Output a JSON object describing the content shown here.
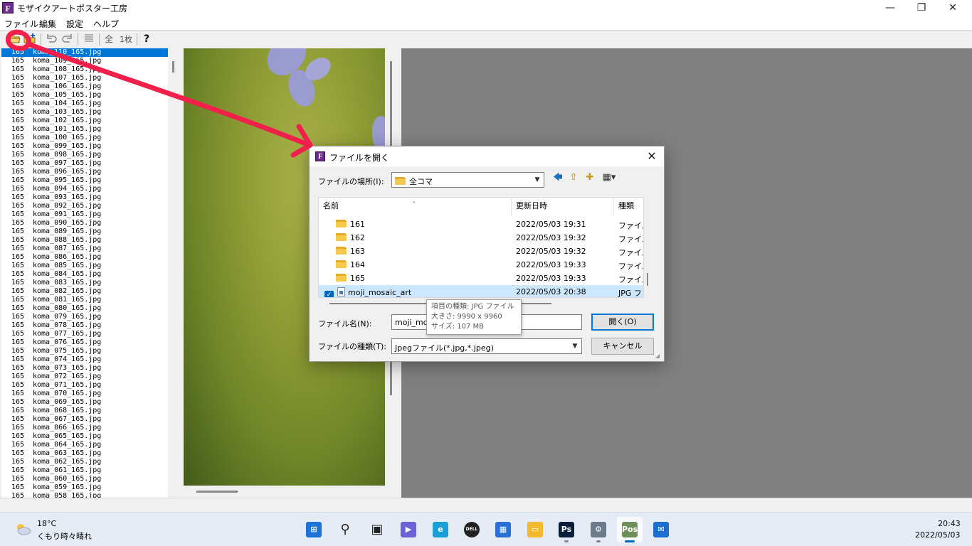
{
  "window": {
    "title": "モザイクアートポスター工房",
    "icon_letter": "F",
    "controls": {
      "minimize": "—",
      "maximize": "❐",
      "close": "✕"
    }
  },
  "menu": [
    "ファイル",
    "編集",
    "設定",
    "ヘルプ"
  ],
  "toolbar": {
    "buttons": [
      "open-folder-icon",
      "new-icon",
      "undo-icon",
      "redo-icon",
      "list-icon",
      "all-icon",
      "one-sheet-icon",
      "help-icon"
    ],
    "all_label": "全",
    "one_label": "1枚",
    "help_label": "?"
  },
  "file_list": {
    "items": [
      {
        "n": "165",
        "name": "koma_110_165.jpg"
      },
      {
        "n": "165",
        "name": "koma_109_165.jpg"
      },
      {
        "n": "165",
        "name": "koma_108_165.jpg"
      },
      {
        "n": "165",
        "name": "koma_107_165.jpg"
      },
      {
        "n": "165",
        "name": "koma_106_165.jpg"
      },
      {
        "n": "165",
        "name": "koma_105_165.jpg"
      },
      {
        "n": "165",
        "name": "koma_104_165.jpg"
      },
      {
        "n": "165",
        "name": "koma_103_165.jpg"
      },
      {
        "n": "165",
        "name": "koma_102_165.jpg"
      },
      {
        "n": "165",
        "name": "koma_101_165.jpg"
      },
      {
        "n": "165",
        "name": "koma_100_165.jpg"
      },
      {
        "n": "165",
        "name": "koma_099_165.jpg"
      },
      {
        "n": "165",
        "name": "koma_098_165.jpg"
      },
      {
        "n": "165",
        "name": "koma_097_165.jpg"
      },
      {
        "n": "165",
        "name": "koma_096_165.jpg"
      },
      {
        "n": "165",
        "name": "koma_095_165.jpg"
      },
      {
        "n": "165",
        "name": "koma_094_165.jpg"
      },
      {
        "n": "165",
        "name": "koma_093_165.jpg"
      },
      {
        "n": "165",
        "name": "koma_092_165.jpg"
      },
      {
        "n": "165",
        "name": "koma_091_165.jpg"
      },
      {
        "n": "165",
        "name": "koma_090_165.jpg"
      },
      {
        "n": "165",
        "name": "koma_089_165.jpg"
      },
      {
        "n": "165",
        "name": "koma_088_165.jpg"
      },
      {
        "n": "165",
        "name": "koma_087_165.jpg"
      },
      {
        "n": "165",
        "name": "koma_086_165.jpg"
      },
      {
        "n": "165",
        "name": "koma_085_165.jpg"
      },
      {
        "n": "165",
        "name": "koma_084_165.jpg"
      },
      {
        "n": "165",
        "name": "koma_083_165.jpg"
      },
      {
        "n": "165",
        "name": "koma_082_165.jpg"
      },
      {
        "n": "165",
        "name": "koma_081_165.jpg"
      },
      {
        "n": "165",
        "name": "koma_080_165.jpg"
      },
      {
        "n": "165",
        "name": "koma_079_165.jpg"
      },
      {
        "n": "165",
        "name": "koma_078_165.jpg"
      },
      {
        "n": "165",
        "name": "koma_077_165.jpg"
      },
      {
        "n": "165",
        "name": "koma_076_165.jpg"
      },
      {
        "n": "165",
        "name": "koma_075_165.jpg"
      },
      {
        "n": "165",
        "name": "koma_074_165.jpg"
      },
      {
        "n": "165",
        "name": "koma_073_165.jpg"
      },
      {
        "n": "165",
        "name": "koma_072_165.jpg"
      },
      {
        "n": "165",
        "name": "koma_071_165.jpg"
      },
      {
        "n": "165",
        "name": "koma_070_165.jpg"
      },
      {
        "n": "165",
        "name": "koma_069_165.jpg"
      },
      {
        "n": "165",
        "name": "koma_068_165.jpg"
      },
      {
        "n": "165",
        "name": "koma_067_165.jpg"
      },
      {
        "n": "165",
        "name": "koma_066_165.jpg"
      },
      {
        "n": "165",
        "name": "koma_065_165.jpg"
      },
      {
        "n": "165",
        "name": "koma_064_165.jpg"
      },
      {
        "n": "165",
        "name": "koma_063_165.jpg"
      },
      {
        "n": "165",
        "name": "koma_062_165.jpg"
      },
      {
        "n": "165",
        "name": "koma_061_165.jpg"
      },
      {
        "n": "165",
        "name": "koma_060_165.jpg"
      },
      {
        "n": "165",
        "name": "koma_059_165.jpg"
      },
      {
        "n": "165",
        "name": "koma_058_165.jpg"
      }
    ],
    "selected_index": 0
  },
  "dialog": {
    "title": "ファイルを開く",
    "icon_letter": "F",
    "close": "✕",
    "location_label": "ファイルの場所(I):",
    "location_value": "全コマ",
    "nav_icons": {
      "back": "🡄",
      "up": "⇧",
      "new_folder": "✚",
      "view": "▦"
    },
    "columns": [
      "名前",
      "更新日時",
      "種類"
    ],
    "rows": [
      {
        "name": "161",
        "date": "2022/05/03 19:31",
        "type": "ファイル",
        "kind": "folder"
      },
      {
        "name": "162",
        "date": "2022/05/03 19:32",
        "type": "ファイル",
        "kind": "folder"
      },
      {
        "name": "163",
        "date": "2022/05/03 19:32",
        "type": "ファイル",
        "kind": "folder"
      },
      {
        "name": "164",
        "date": "2022/05/03 19:33",
        "type": "ファイル",
        "kind": "folder"
      },
      {
        "name": "165",
        "date": "2022/05/03 19:33",
        "type": "ファイル",
        "kind": "folder"
      },
      {
        "name": "moji_mosaic_art",
        "date": "2022/05/03 20:38",
        "type": "JPG フ",
        "kind": "jpg",
        "selected": true
      }
    ],
    "filename_label": "ファイル名(N):",
    "filename_value": "moji_mo",
    "filetype_label": "ファイルの種類(T):",
    "filetype_value": "Jpegファイル(*.jpg,*.jpeg)",
    "open_button": "開く(O)",
    "cancel_button": "キャンセル",
    "tooltip": {
      "type": "項目の種類: JPG ファイル",
      "size": "大きさ: 9990 x 9960",
      "filesize": "サイズ: 107 MB"
    }
  },
  "taskbar": {
    "weather_temp": "18°C",
    "weather_desc": "くもり時々晴れ",
    "apps": [
      {
        "name": "windows-start",
        "color": "#1b74d6",
        "glyph": "⊞",
        "active": false,
        "running": false
      },
      {
        "name": "search",
        "color": "transparent",
        "glyph": "⚲",
        "active": false,
        "running": false
      },
      {
        "name": "task-view",
        "color": "transparent",
        "glyph": "▣",
        "active": false,
        "running": false
      },
      {
        "name": "chat",
        "color": "#6b63d6",
        "glyph": "▶",
        "active": false,
        "running": false
      },
      {
        "name": "edge",
        "color": "#1a9fd6",
        "glyph": "e",
        "active": false,
        "running": false
      },
      {
        "name": "dell",
        "color": "#222222",
        "glyph": "DELL",
        "active": false,
        "running": false
      },
      {
        "name": "store",
        "color": "#2a6fd6",
        "glyph": "▦",
        "active": false,
        "running": false
      },
      {
        "name": "explorer",
        "color": "#f2b92c",
        "glyph": "▭",
        "active": false,
        "running": false
      },
      {
        "name": "photoshop",
        "color": "#0a1f3c",
        "glyph": "Ps",
        "active": false,
        "running": true
      },
      {
        "name": "settings",
        "color": "#6c7a8a",
        "glyph": "⚙",
        "active": false,
        "running": true
      },
      {
        "name": "poster-app",
        "color": "#6f8f5a",
        "glyph": "Pos",
        "active": true,
        "running": true
      },
      {
        "name": "mail",
        "color": "#1a6fd0",
        "glyph": "✉",
        "active": false,
        "running": false
      }
    ],
    "time": "20:43",
    "date": "2022/05/03"
  },
  "colors": {
    "selection_blue": "#0078d7",
    "annotation_red": "#f0204a"
  }
}
